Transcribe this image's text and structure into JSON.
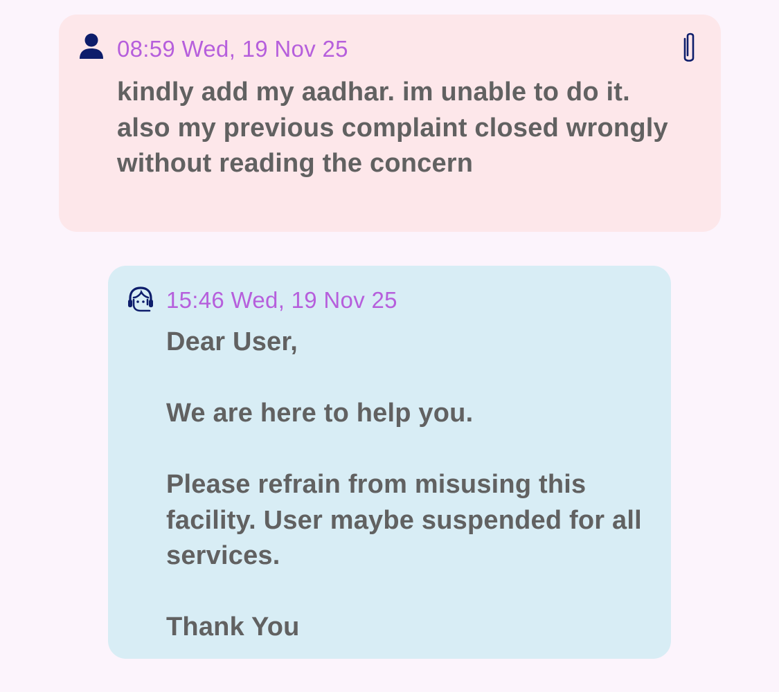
{
  "colors": {
    "page_background": "#fcf4fc",
    "user_bubble": "#fde7ea",
    "agent_bubble": "#d8edf5",
    "timestamp": "#b65fdc",
    "message_text": "#616161",
    "icon": "#0d1d6b"
  },
  "thread": {
    "user_message": {
      "avatar_icon": "user-icon",
      "timestamp": "08:59 Wed, 19 Nov 25",
      "attachment_icon": "paperclip-icon",
      "text": "kindly add my aadhar. im unable to do it. also my previous complaint closed wrongly without reading the concern"
    },
    "agent_message": {
      "avatar_icon": "support-agent-icon",
      "timestamp": "15:46 Wed, 19 Nov 25",
      "text": "Dear User,\n\nWe are here to help you.\n\nPlease refrain from misusing this facility. User maybe suspended for all  services.\n\nThank You"
    }
  }
}
